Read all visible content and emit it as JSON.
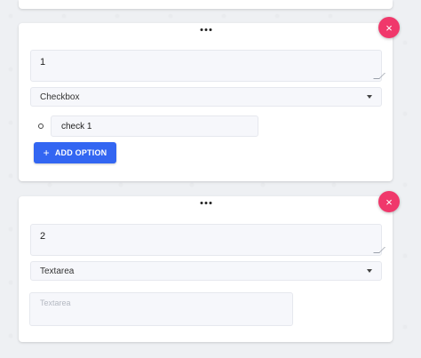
{
  "icons": {
    "drag": "drag-handle-icon",
    "delete": "close-icon",
    "add": "plus-icon",
    "dropdown": "chevron-down-icon",
    "option": "radio-bullet-icon"
  },
  "colors": {
    "delete": "#f0386b",
    "primary": "#3366f2",
    "field_bg": "#f6f7fb"
  },
  "questions": [
    {
      "question_text": "1",
      "type_selected": "Checkbox",
      "options": [
        {
          "label": "check 1"
        }
      ],
      "add_option_label": "ADD OPTION",
      "add_option_symbol": "+",
      "delete_symbol": "×"
    },
    {
      "question_text": "2",
      "type_selected": "Textarea",
      "answer_placeholder": "Textarea",
      "delete_symbol": "×"
    }
  ]
}
